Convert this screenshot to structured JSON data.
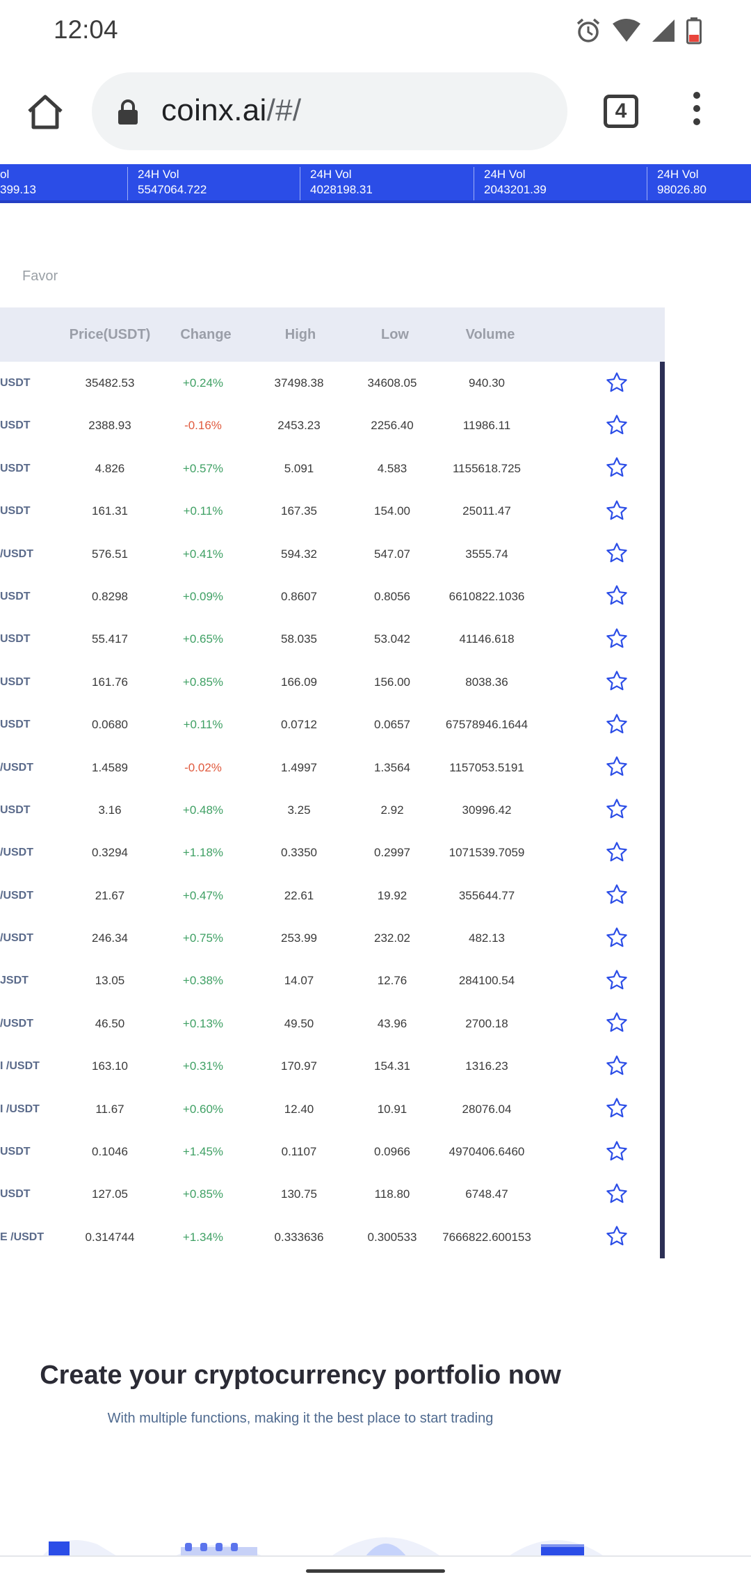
{
  "status_bar": {
    "time": "12:04",
    "icons": [
      "alarm-icon",
      "wifi-icon",
      "cell-signal-icon",
      "battery-icon"
    ]
  },
  "browser": {
    "url_host": "coinx.ai",
    "url_path": "/#/",
    "tab_count": "4",
    "icons": [
      "home-icon",
      "lock-icon",
      "tabs-icon",
      "more-vert-icon"
    ]
  },
  "ticker": [
    {
      "label": "ol",
      "value": "399.13"
    },
    {
      "label": "24H Vol",
      "value": "5547064.722"
    },
    {
      "label": "24H Vol",
      "value": "4028198.31"
    },
    {
      "label": "24H Vol",
      "value": "2043201.39"
    },
    {
      "label": "24H Vol",
      "value": "98026.80"
    }
  ],
  "favor_label": "Favor",
  "table": {
    "headers": {
      "price": "Price(USDT)",
      "change": "Change",
      "high": "High",
      "low": "Low",
      "volume": "Volume"
    },
    "rows": [
      {
        "pair": "USDT",
        "price": "35482.53",
        "change": "+0.24%",
        "dir": "up",
        "high": "37498.38",
        "low": "34608.05",
        "volume": "940.30"
      },
      {
        "pair": "USDT",
        "price": "2388.93",
        "change": "-0.16%",
        "dir": "down",
        "high": "2453.23",
        "low": "2256.40",
        "volume": "11986.11"
      },
      {
        "pair": "USDT",
        "price": "4.826",
        "change": "+0.57%",
        "dir": "up",
        "high": "5.091",
        "low": "4.583",
        "volume": "1155618.725"
      },
      {
        "pair": "USDT",
        "price": "161.31",
        "change": "+0.11%",
        "dir": "up",
        "high": "167.35",
        "low": "154.00",
        "volume": "25011.47"
      },
      {
        "pair": "/USDT",
        "price": "576.51",
        "change": "+0.41%",
        "dir": "up",
        "high": "594.32",
        "low": "547.07",
        "volume": "3555.74"
      },
      {
        "pair": "USDT",
        "price": "0.8298",
        "change": "+0.09%",
        "dir": "up",
        "high": "0.8607",
        "low": "0.8056",
        "volume": "6610822.1036"
      },
      {
        "pair": "USDT",
        "price": "55.417",
        "change": "+0.65%",
        "dir": "up",
        "high": "58.035",
        "low": "53.042",
        "volume": "41146.618"
      },
      {
        "pair": "USDT",
        "price": "161.76",
        "change": "+0.85%",
        "dir": "up",
        "high": "166.09",
        "low": "156.00",
        "volume": "8038.36"
      },
      {
        "pair": "USDT",
        "price": "0.0680",
        "change": "+0.11%",
        "dir": "up",
        "high": "0.0712",
        "low": "0.0657",
        "volume": "67578946.1644"
      },
      {
        "pair": "/USDT",
        "price": "1.4589",
        "change": "-0.02%",
        "dir": "down",
        "high": "1.4997",
        "low": "1.3564",
        "volume": "1157053.5191"
      },
      {
        "pair": "USDT",
        "price": "3.16",
        "change": "+0.48%",
        "dir": "up",
        "high": "3.25",
        "low": "2.92",
        "volume": "30996.42"
      },
      {
        "pair": "/USDT",
        "price": "0.3294",
        "change": "+1.18%",
        "dir": "up",
        "high": "0.3350",
        "low": "0.2997",
        "volume": "1071539.7059"
      },
      {
        "pair": "/USDT",
        "price": "21.67",
        "change": "+0.47%",
        "dir": "up",
        "high": "22.61",
        "low": "19.92",
        "volume": "355644.77"
      },
      {
        "pair": "/USDT",
        "price": "246.34",
        "change": "+0.75%",
        "dir": "up",
        "high": "253.99",
        "low": "232.02",
        "volume": "482.13"
      },
      {
        "pair": "JSDT",
        "price": "13.05",
        "change": "+0.38%",
        "dir": "up",
        "high": "14.07",
        "low": "12.76",
        "volume": "284100.54"
      },
      {
        "pair": "/USDT",
        "price": "46.50",
        "change": "+0.13%",
        "dir": "up",
        "high": "49.50",
        "low": "43.96",
        "volume": "2700.18"
      },
      {
        "pair": "I /USDT",
        "price": "163.10",
        "change": "+0.31%",
        "dir": "up",
        "high": "170.97",
        "low": "154.31",
        "volume": "1316.23"
      },
      {
        "pair": "I /USDT",
        "price": "11.67",
        "change": "+0.60%",
        "dir": "up",
        "high": "12.40",
        "low": "10.91",
        "volume": "28076.04"
      },
      {
        "pair": "USDT",
        "price": "0.1046",
        "change": "+1.45%",
        "dir": "up",
        "high": "0.1107",
        "low": "0.0966",
        "volume": "4970406.6460"
      },
      {
        "pair": "USDT",
        "price": "127.05",
        "change": "+0.85%",
        "dir": "up",
        "high": "130.75",
        "low": "118.80",
        "volume": "6748.47"
      },
      {
        "pair": "E /USDT",
        "price": "0.314744",
        "change": "+1.34%",
        "dir": "up",
        "high": "0.333636",
        "low": "0.300533",
        "volume": "7666822.600153"
      }
    ]
  },
  "promo": {
    "title": "Create your cryptocurrency portfolio now",
    "subtitle": "With multiple functions, making it the best place to start trading"
  },
  "colors": {
    "ticker_bg": "#2b4de7",
    "up": "#3fa064",
    "down": "#e05a3e",
    "star": "#2b4de7",
    "header_bg": "#e8ebf4"
  }
}
